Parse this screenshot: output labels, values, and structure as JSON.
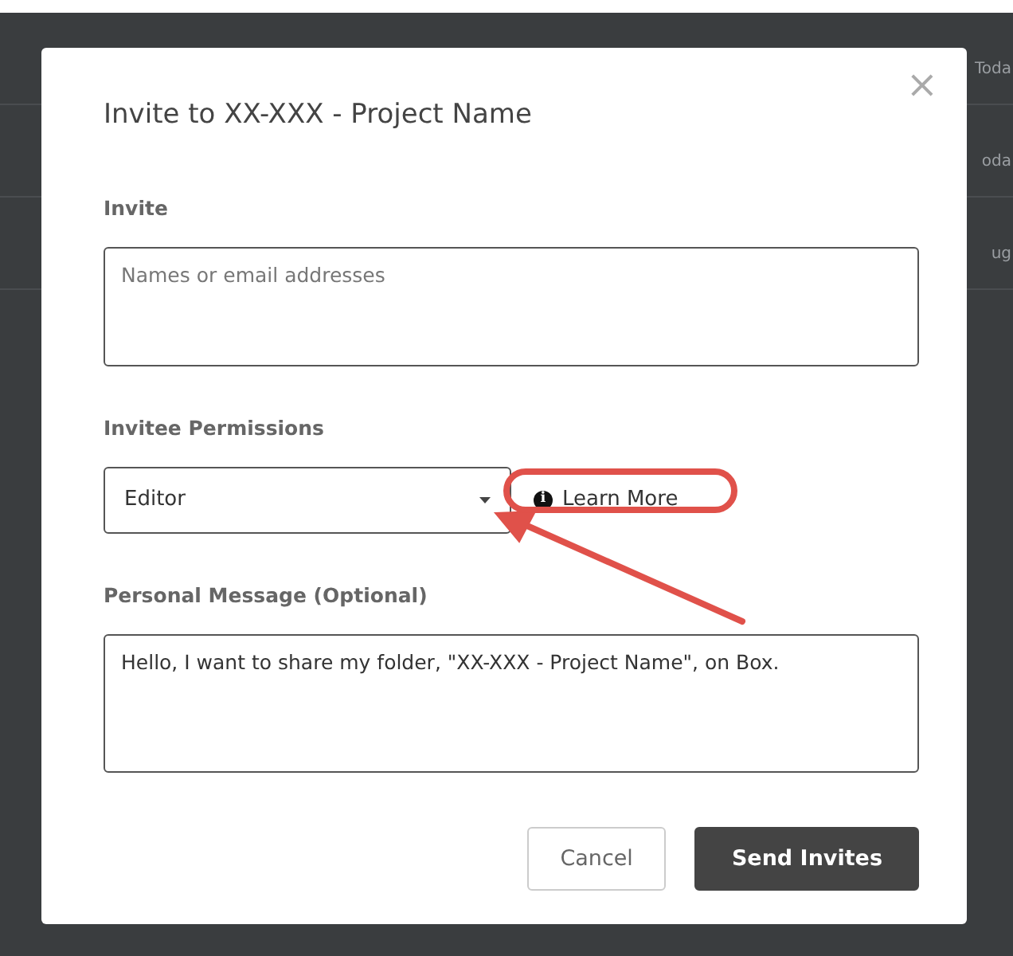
{
  "background": {
    "rows": [
      "Toda",
      "oda",
      "ug"
    ]
  },
  "dialog": {
    "title": "Invite to XX-XXX - Project Name",
    "close": "×",
    "invite": {
      "label": "Invite",
      "placeholder": "Names or email addresses"
    },
    "permissions": {
      "label": "Invitee Permissions",
      "value": "Editor",
      "learn_more": "Learn More",
      "info": "i"
    },
    "message": {
      "label": "Personal Message (Optional)",
      "value": "Hello, I want to share my folder, \"XX-XXX - Project Name\", on Box."
    },
    "buttons": [
      {
        "label": "Cancel",
        "kind": "secondary"
      },
      {
        "label": "Send Invites",
        "kind": "primary"
      }
    ]
  }
}
